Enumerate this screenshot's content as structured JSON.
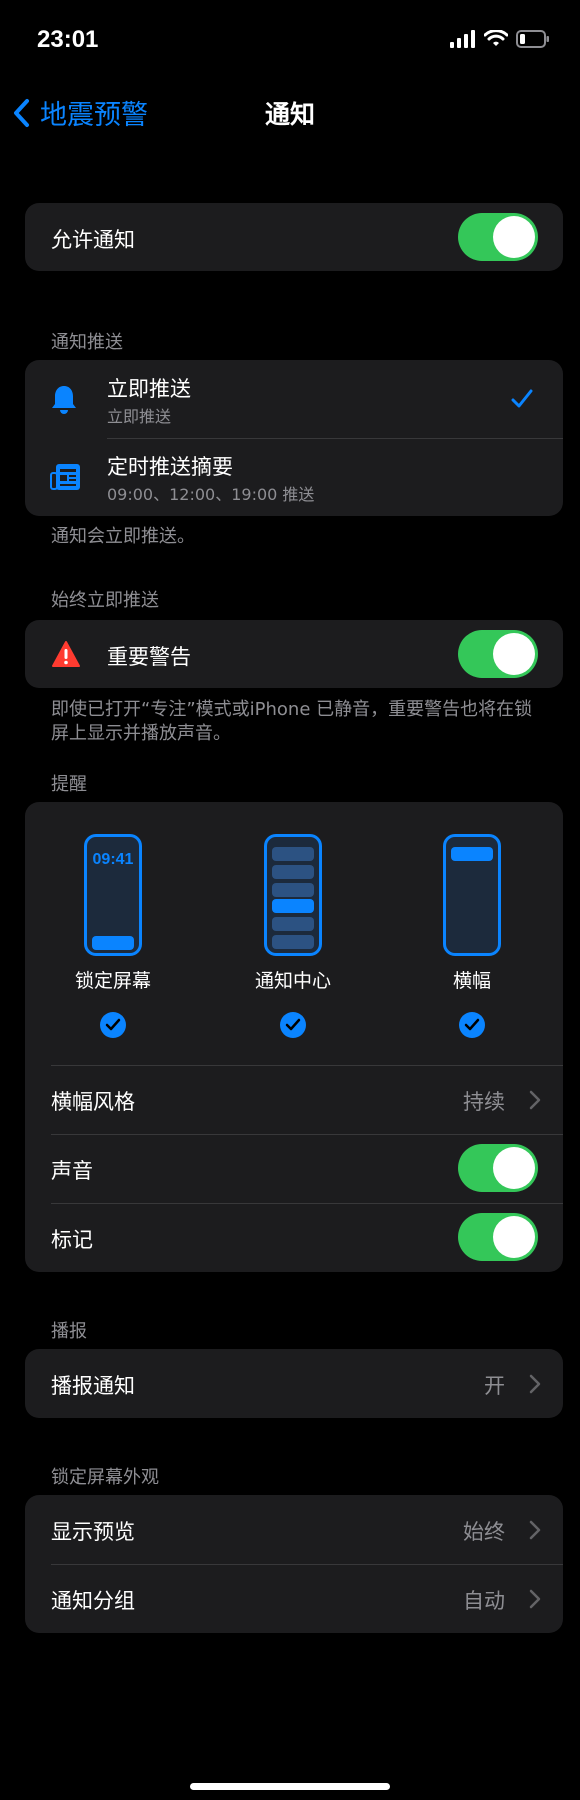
{
  "status_bar": {
    "time": "23:01"
  },
  "nav": {
    "back_label": "地震预警",
    "title": "通知"
  },
  "allow": {
    "label": "允许通知",
    "on": true
  },
  "delivery": {
    "header": "通知推送",
    "items": [
      {
        "label": "立即推送",
        "sub": "立即推送",
        "selected": true,
        "icon": "bell-icon"
      },
      {
        "label": "定时推送摘要",
        "sub": "09:00、12:00、19:00 推送",
        "selected": false,
        "icon": "newspaper-icon"
      }
    ],
    "footnote": "通知会立即推送。"
  },
  "always": {
    "header": "始终立即推送",
    "critical_label": "重要警告",
    "on": true,
    "footnote": "即使已打开“专注”模式或iPhone 已静音，重要警告也将在锁屏上显示并播放声音。"
  },
  "alerts": {
    "header": "提醒",
    "styles": [
      {
        "label": "锁定屏幕",
        "clock": "09:41",
        "checked": true
      },
      {
        "label": "通知中心",
        "checked": true
      },
      {
        "label": "横幅",
        "checked": true
      }
    ],
    "banner_style_label": "横幅风格",
    "banner_style_value": "持续",
    "sound_label": "声音",
    "sound_on": true,
    "badge_label": "标记",
    "badge_on": true
  },
  "announce": {
    "header": "播报",
    "label": "播报通知",
    "value": "开"
  },
  "lockscreen": {
    "header": "锁定屏幕外观",
    "show_preview_label": "显示预览",
    "show_preview_value": "始终",
    "grouping_label": "通知分组",
    "grouping_value": "自动"
  },
  "colors": {
    "accent": "#0a84ff",
    "toggle_on": "#34c759",
    "warning": "#ff3b30"
  }
}
